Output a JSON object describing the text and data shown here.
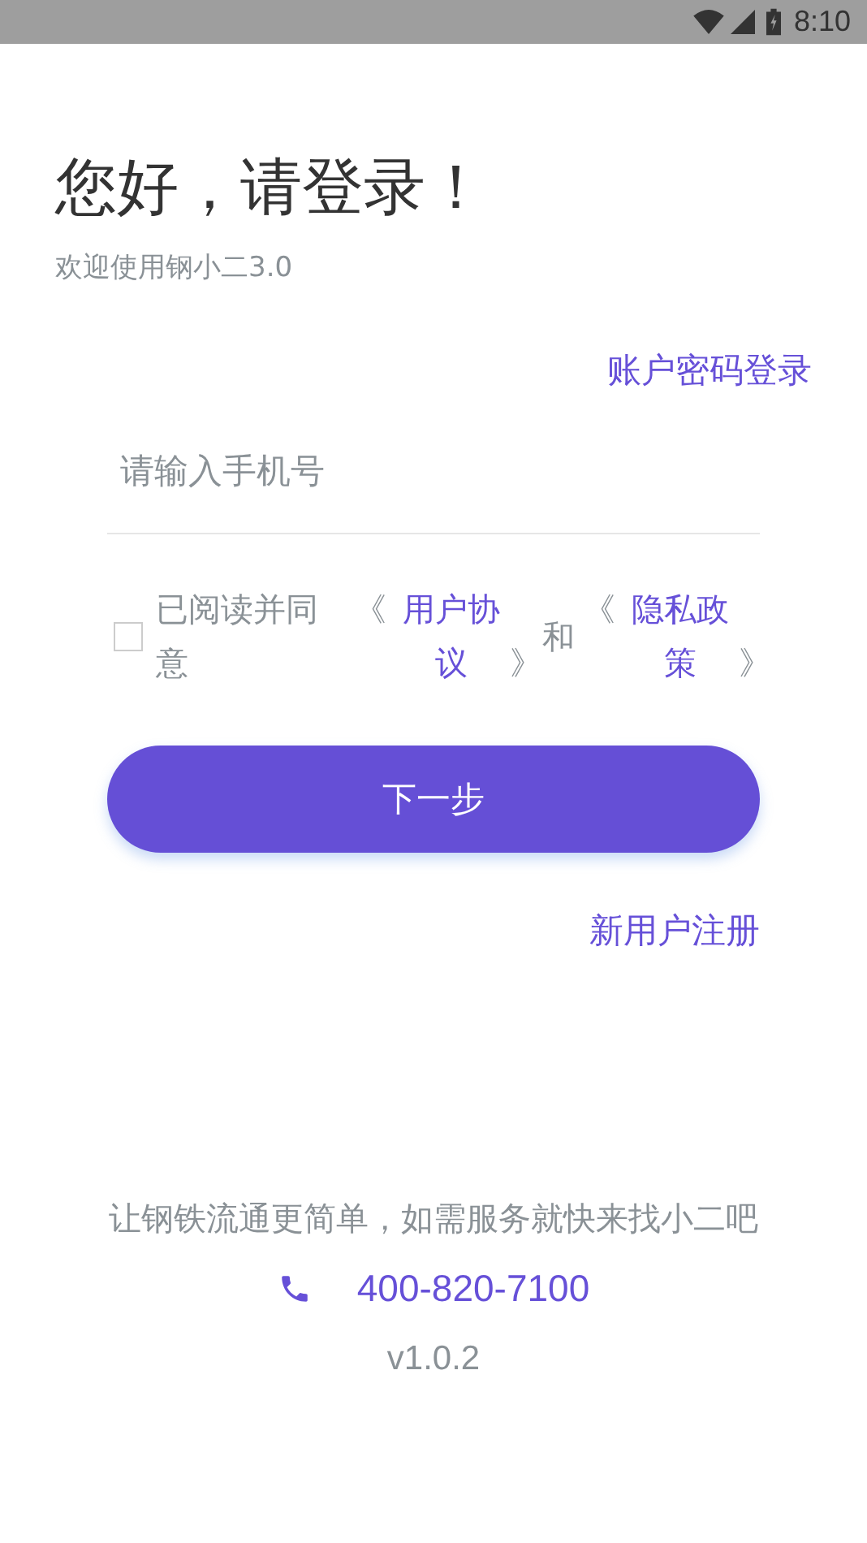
{
  "status_bar": {
    "time": "8:10"
  },
  "title": "您好，请登录！",
  "subtitle": "欢迎使用钢小二3.0",
  "password_login_link": "账户密码登录",
  "phone_field": {
    "placeholder": "请输入手机号"
  },
  "agreement": {
    "checked": false,
    "parts": [
      {
        "kind": "text",
        "text": "已阅读并同意"
      },
      {
        "kind": "open",
        "text": "《"
      },
      {
        "kind": "link",
        "text": "用户协议"
      },
      {
        "kind": "close",
        "text": "》"
      },
      {
        "kind": "joiner",
        "text": "和"
      },
      {
        "kind": "open",
        "text": "《"
      },
      {
        "kind": "link",
        "text": "隐私政策"
      },
      {
        "kind": "close",
        "text": "》"
      }
    ]
  },
  "next_button": "下一步",
  "register_link": "新用户注册",
  "footer": {
    "slogan": "让钢铁流通更简单，如需服务就快来找小二吧",
    "phone": "400-820-7100",
    "version": "v1.0.2"
  }
}
